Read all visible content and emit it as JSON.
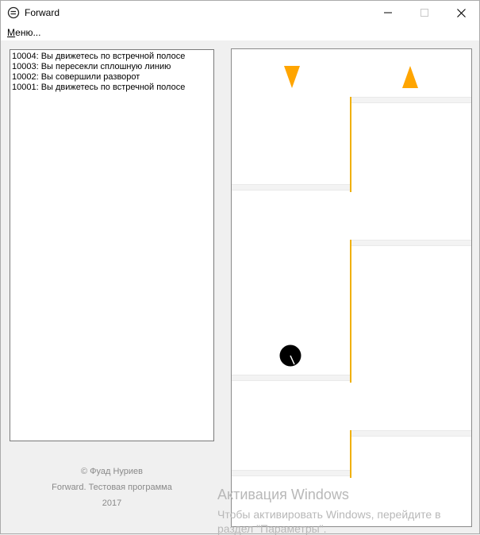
{
  "window": {
    "title": "Forward",
    "accent": "#f0b000"
  },
  "menu": {
    "hotkey": "М",
    "rest": "еню..."
  },
  "log": {
    "lines": [
      "10004: Вы движетесь по встречной полосе",
      "10003: Вы пересекли сплошную линию",
      "10002: Вы совершили разворот",
      "10001: Вы движетесь по встречной полосе"
    ]
  },
  "footer": {
    "copyright": "© Фуад Нуриев",
    "program": "Forward. Тестовая программа",
    "year": "2017"
  },
  "watermark": {
    "title": "Активация Windows",
    "line1": "Чтобы активировать Windows, перейдите в",
    "line2": "раздел \"Параметры\"."
  },
  "icons": {
    "app": "forward-logo-icon",
    "minimize": "minimize-icon",
    "maximize": "maximize-icon",
    "close": "close-icon",
    "left_arrow": "down-arrow-icon",
    "right_arrow": "up-arrow-icon",
    "car": "car-icon"
  }
}
